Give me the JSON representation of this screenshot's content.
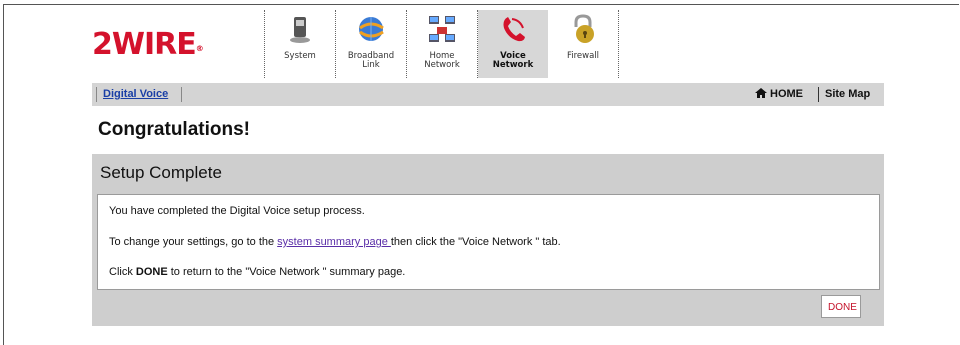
{
  "header": {
    "logo_text": "2WIRE",
    "logo_mark": "®",
    "tabs": [
      {
        "label": "System",
        "icon": "computer-icon",
        "active": false
      },
      {
        "label": "Broadband\nLink",
        "icon": "globe-icon",
        "active": false
      },
      {
        "label": "Home\nNetwork",
        "icon": "network-icon",
        "active": false
      },
      {
        "label": "Voice\nNetwork",
        "icon": "phone-icon",
        "active": true
      },
      {
        "label": "Firewall",
        "icon": "padlock-icon",
        "active": false
      }
    ]
  },
  "nav": {
    "section_link": "Digital Voice",
    "home_label": "HOME",
    "sitemap_label": "Site Map"
  },
  "page": {
    "title": "Congratulations!"
  },
  "panel": {
    "title": "Setup Complete",
    "line1": "You have completed the Digital Voice setup process.",
    "line2_prefix": "To change your settings, go to the ",
    "line2_link": "system summary page ",
    "line2_suffix": "then click the \"Voice Network \" tab.",
    "line3_prefix": "Click ",
    "line3_bold": "DONE",
    "line3_suffix": " to return to the \"Voice Network \" summary page.",
    "done_label": "DONE"
  },
  "colors": {
    "brand_red": "#d4122c",
    "nav_gray": "#d4d4d4",
    "panel_gray": "#cecece",
    "link_blue": "#1a3fa6",
    "link_purple": "#5a2ea8"
  }
}
